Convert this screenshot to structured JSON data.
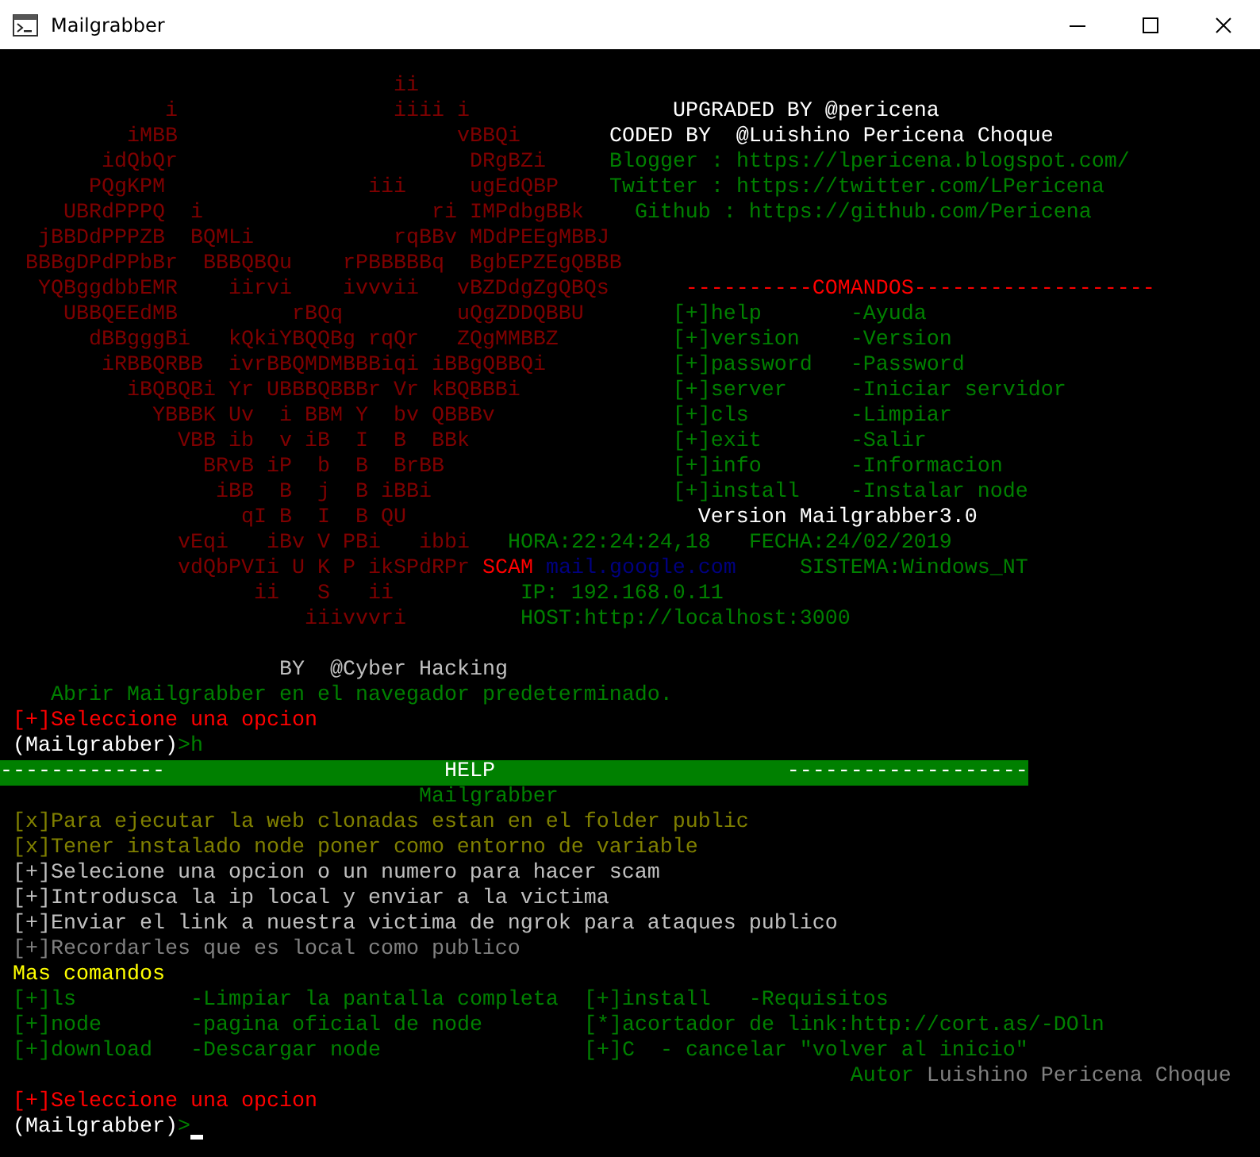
{
  "window": {
    "title": "Mailgrabber"
  },
  "lines": [
    {
      "kind": "text",
      "segments": [
        {
          "text": "                               ii",
          "color": "#800000"
        }
      ]
    },
    {
      "kind": "text",
      "segments": [
        {
          "text": "             i",
          "color": "#800000"
        },
        {
          "text": "                 iiii i",
          "color": "#800000"
        },
        {
          "text": "                UPGRADED BY @pericena",
          "color": "#ffffff"
        }
      ]
    },
    {
      "kind": "text",
      "segments": [
        {
          "text": "          iMBB",
          "color": "#800000"
        },
        {
          "text": "                      vBBQi",
          "color": "#800000"
        },
        {
          "text": "       CODED BY  @Luishino Pericena Choque",
          "color": "#ffffff"
        }
      ]
    },
    {
      "kind": "text",
      "segments": [
        {
          "text": "        idQbQr",
          "color": "#800000"
        },
        {
          "text": "                       DRgBZi",
          "color": "#800000"
        },
        {
          "text": "     Blogger : https://lpericena.blogspot.com/",
          "color": "#008000"
        }
      ]
    },
    {
      "kind": "text",
      "segments": [
        {
          "text": "       PQgKPM",
          "color": "#800000"
        },
        {
          "text": "                iii     ugEdQBP",
          "color": "#800000"
        },
        {
          "text": "    Twitter : https://twitter.com/LPericena",
          "color": "#008000"
        }
      ]
    },
    {
      "kind": "text",
      "segments": [
        {
          "text": "     UBRdPPPQ  i",
          "color": "#800000"
        },
        {
          "text": "                  ri IMPdbgBBk",
          "color": "#800000"
        },
        {
          "text": "    Github : https://github.com/Pericena",
          "color": "#008000"
        }
      ]
    },
    {
      "kind": "text",
      "segments": [
        {
          "text": "   jBBDdPPPZB  BQMLi",
          "color": "#800000"
        },
        {
          "text": "           rqBBv MDdPEEgMBBJ",
          "color": "#800000"
        }
      ]
    },
    {
      "kind": "text",
      "segments": [
        {
          "text": "  BBBgDPdPPbBr  BBBQBQu    rPBBBBBq  BgbEPZEgQBBB",
          "color": "#800000"
        }
      ]
    },
    {
      "kind": "text",
      "segments": [
        {
          "text": "   YQBggdbbEMR    iirvi    ivvvii   vBZDdgZgQBQs",
          "color": "#800000"
        },
        {
          "text": "      ----------COMANDOS-------------------",
          "color": "#ff0000"
        }
      ]
    },
    {
      "kind": "text",
      "segments": [
        {
          "text": "     UBBQEEdMB         rBQq         uQgZDDQBBU",
          "color": "#800000"
        },
        {
          "text": "       [+]help",
          "color": "#008000"
        },
        {
          "text": "       -Ayuda",
          "color": "#008000"
        }
      ]
    },
    {
      "kind": "text",
      "segments": [
        {
          "text": "       dBBgggBi   kQkiYBQQBg rqQr   ZQgMMBBZ",
          "color": "#800000"
        },
        {
          "text": "         [+]version",
          "color": "#008000"
        },
        {
          "text": "    -Version",
          "color": "#008000"
        }
      ]
    },
    {
      "kind": "text",
      "segments": [
        {
          "text": "        iRBBQRBB  ivrBBQMDMBBBiqi iBBgQBBQi",
          "color": "#800000"
        },
        {
          "text": "          [+]password",
          "color": "#008000"
        },
        {
          "text": "   -Password",
          "color": "#008000"
        }
      ]
    },
    {
      "kind": "text",
      "segments": [
        {
          "text": "          iBQBQBi Yr UBBBQBBBr Vr kBQBBBi",
          "color": "#800000"
        },
        {
          "text": "            [+]server",
          "color": "#008000"
        },
        {
          "text": "     -Iniciar servidor",
          "color": "#008000"
        }
      ]
    },
    {
      "kind": "text",
      "segments": [
        {
          "text": "            YBBBK Uv  i BBM Y  bv QBBBv",
          "color": "#800000"
        },
        {
          "text": "              [+]cls",
          "color": "#008000"
        },
        {
          "text": "        -Limpiar",
          "color": "#008000"
        }
      ]
    },
    {
      "kind": "text",
      "segments": [
        {
          "text": "              VBB ib  v iB  I  B  BBk",
          "color": "#800000"
        },
        {
          "text": "                [+]exit",
          "color": "#008000"
        },
        {
          "text": "       -Salir",
          "color": "#008000"
        }
      ]
    },
    {
      "kind": "text",
      "segments": [
        {
          "text": "                BRvB iP  b  B  BrBB",
          "color": "#800000"
        },
        {
          "text": "                  [+]info",
          "color": "#008000"
        },
        {
          "text": "       -Informacion",
          "color": "#008000"
        }
      ]
    },
    {
      "kind": "text",
      "segments": [
        {
          "text": "                 iBB  B  j  B iBBi",
          "color": "#800000"
        },
        {
          "text": "                   [+]install",
          "color": "#008000"
        },
        {
          "text": "    -Instalar node",
          "color": "#008000"
        }
      ]
    },
    {
      "kind": "text",
      "segments": [
        {
          "text": "                   qI B  I  B QU",
          "color": "#800000"
        },
        {
          "text": "                       Version Mailgrabber3.0",
          "color": "#ffffff"
        }
      ]
    },
    {
      "kind": "text",
      "segments": [
        {
          "text": "              vEqi   iBv V PBi   ibbi",
          "color": "#800000"
        },
        {
          "text": "   HORA:22:24:24,18",
          "color": "#008000"
        },
        {
          "text": "   FECHA:24/02/2019",
          "color": "#008000"
        }
      ]
    },
    {
      "kind": "text",
      "segments": [
        {
          "text": "              vdQbPVIi U K P ikSPdRPr",
          "color": "#800000"
        },
        {
          "text": " SCAM",
          "color": "#ff0000"
        },
        {
          "text": " mail.google.com",
          "color": "#000080"
        },
        {
          "text": "     SISTEMA:Windows_NT",
          "color": "#008000"
        }
      ]
    },
    {
      "kind": "text",
      "segments": [
        {
          "text": "                    ii   S   ii",
          "color": "#800000"
        },
        {
          "text": "          IP: 192.168.0.11",
          "color": "#008000"
        }
      ]
    },
    {
      "kind": "text",
      "segments": [
        {
          "text": "                        iiivvvri",
          "color": "#800000"
        },
        {
          "text": "         HOST:http://localhost:3000",
          "color": "#008000"
        }
      ]
    },
    {
      "kind": "blank"
    },
    {
      "kind": "text",
      "segments": [
        {
          "text": "                      BY  @Cyber Hacking",
          "color": "#c0c0c0"
        }
      ]
    },
    {
      "kind": "text",
      "segments": [
        {
          "text": "    Abrir Mailgrabber en el navegador predeterminado.",
          "color": "#008000"
        }
      ]
    },
    {
      "kind": "text",
      "segments": [
        {
          "text": " [+]Seleccione una opcion",
          "color": "#ff0000"
        }
      ]
    },
    {
      "kind": "text",
      "segments": [
        {
          "text": " (Mailgrabber)",
          "color": "#ffffff"
        },
        {
          "text": ">h",
          "color": "#008000"
        }
      ]
    },
    {
      "kind": "banner",
      "segments": [
        {
          "text": "-------------"
        },
        {
          "text": "                      HELP"
        },
        {
          "text": "                       -------------------"
        }
      ]
    },
    {
      "kind": "text",
      "segments": [
        {
          "text": "                                 Mailgrabber",
          "color": "#008000"
        }
      ]
    },
    {
      "kind": "text",
      "segments": [
        {
          "text": " [x]Para ejecutar la web clonadas estan en el folder public",
          "color": "#808000"
        }
      ]
    },
    {
      "kind": "text",
      "segments": [
        {
          "text": " [x]Tener instalado node poner como entorno de variable",
          "color": "#808000"
        }
      ]
    },
    {
      "kind": "text",
      "segments": [
        {
          "text": " [+]Selecione una opcion o un numero para hacer scam",
          "color": "#c0c0c0"
        }
      ]
    },
    {
      "kind": "text",
      "segments": [
        {
          "text": " [+]Introdusca la ip local y enviar a la victima",
          "color": "#c0c0c0"
        }
      ]
    },
    {
      "kind": "text",
      "segments": [
        {
          "text": " [+]Enviar el link a nuestra victima de ngrok para ataques publico",
          "color": "#c0c0c0"
        }
      ]
    },
    {
      "kind": "text",
      "segments": [
        {
          "text": " [+]Recordarles que es local como publico",
          "color": "#808080"
        }
      ]
    },
    {
      "kind": "text",
      "segments": [
        {
          "text": " Mas comandos",
          "color": "#ffff00"
        }
      ]
    },
    {
      "kind": "text",
      "segments": [
        {
          "text": " [+]ls",
          "color": "#008000"
        },
        {
          "text": "         -Limpiar la pantalla completa",
          "color": "#008000"
        },
        {
          "text": "  [+]install",
          "color": "#008000"
        },
        {
          "text": "   -Requisitos",
          "color": "#008000"
        }
      ]
    },
    {
      "kind": "text",
      "segments": [
        {
          "text": " [+]node",
          "color": "#008000"
        },
        {
          "text": "       -pagina oficial de node",
          "color": "#008000"
        },
        {
          "text": "        [*]acortador de link:http://cort.as/-DOln",
          "color": "#008000"
        }
      ]
    },
    {
      "kind": "text",
      "segments": [
        {
          "text": " [+]download",
          "color": "#008000"
        },
        {
          "text": "   -Descargar node",
          "color": "#008000"
        },
        {
          "text": "                [+]C  - cancelar \"volver al inicio\"",
          "color": "#008000"
        }
      ]
    },
    {
      "kind": "text",
      "segments": [
        {
          "text": "                                                                   Autor",
          "color": "#008000"
        },
        {
          "text": " Luishino Pericena Choque",
          "color": "#808080"
        }
      ]
    },
    {
      "kind": "text",
      "segments": [
        {
          "text": " [+]Seleccione una opcion",
          "color": "#ff0000"
        }
      ]
    },
    {
      "kind": "prompt",
      "segments": [
        {
          "text": " (Mailgrabber)",
          "color": "#ffffff"
        },
        {
          "text": ">",
          "color": "#008000"
        }
      ]
    }
  ]
}
